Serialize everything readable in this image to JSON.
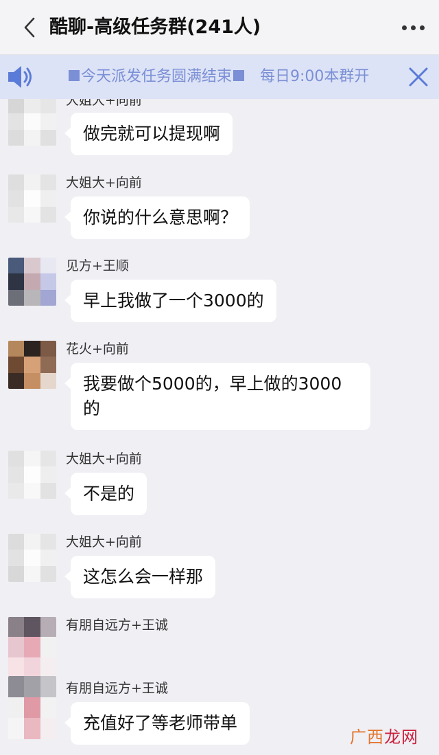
{
  "header": {
    "title": "酷聊-高级任务群(241人)"
  },
  "notice": {
    "text_part1": "今天派发任务圆满结束",
    "text_part2": "每日9:00本群开"
  },
  "colors": {
    "notice_bg": "#dde3f6",
    "notice_text": "#7b8fd6",
    "chat_bg": "#efeff4",
    "bubble_bg": "#ffffff"
  },
  "messages": [
    {
      "sender": "大姐大+向前",
      "text": "做完就可以提现啊"
    },
    {
      "sender": "大姐大+向前",
      "text": "你说的什么意思啊？"
    },
    {
      "sender": "见方+王顺",
      "text": "早上我做了一个3000的"
    },
    {
      "sender": "花火+向前",
      "line1": "我要做个5000的，早上做的3000",
      "line2": "的"
    },
    {
      "sender": "大姐大+向前",
      "text": "不是的"
    },
    {
      "sender": "大姐大+向前",
      "text": "这怎么会一样那"
    },
    {
      "sender": "有朋自远方+王诚",
      "text": ""
    },
    {
      "sender": "有朋自远方+王诚",
      "text": "充值好了等老师带单"
    }
  ],
  "watermark": {
    "part1": "广西",
    "part2": "龙网"
  }
}
